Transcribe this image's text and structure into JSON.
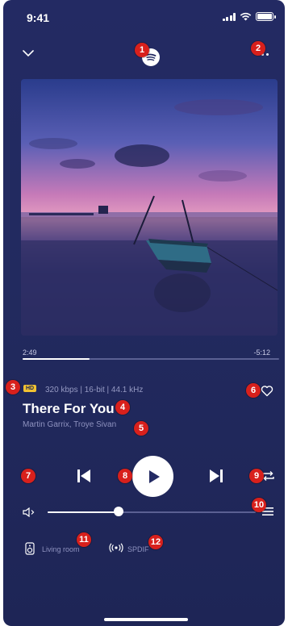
{
  "status_bar": {
    "time": "9:41"
  },
  "header": {
    "collapse_icon": "chevron-down-icon",
    "source_icon": "spotify-icon",
    "more_icon": "more-dots-icon"
  },
  "badges": [
    "1",
    "2",
    "3",
    "4",
    "5",
    "6",
    "7",
    "8",
    "9",
    "10",
    "11",
    "12"
  ],
  "playback": {
    "elapsed": "2:49",
    "remaining": "-5:12",
    "progress": 0.26
  },
  "track": {
    "quality_badge": "HD",
    "quality": "320 kbps | 16-bit | 44.1 kHz",
    "title": "There For You",
    "artist": "Martin Garrix, Troye Sivan"
  },
  "volume": {
    "level": 0.34
  },
  "output": {
    "room": "Living room",
    "connection": "SPDIF"
  },
  "colors": {
    "background": "#222a5f",
    "badge": "#d8201c",
    "hd_badge": "#f1c232",
    "accent": "#ffffff"
  }
}
